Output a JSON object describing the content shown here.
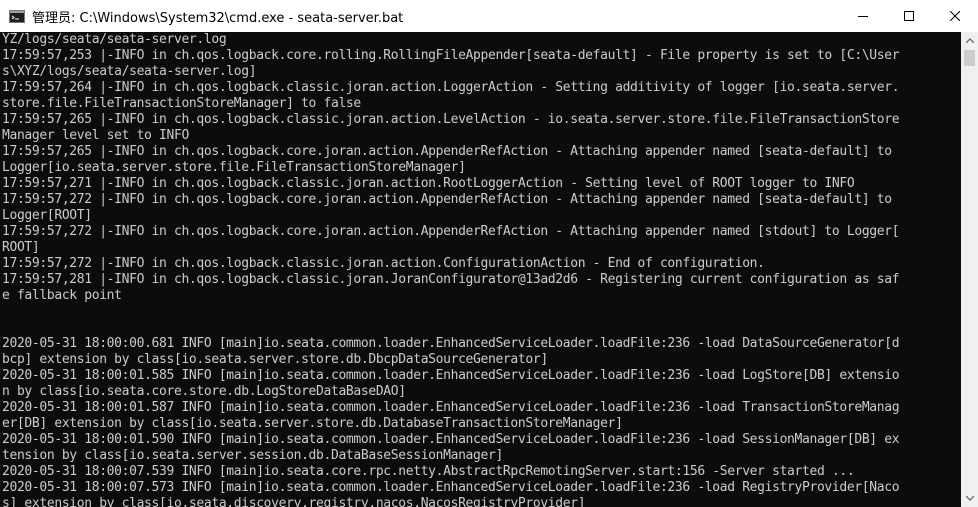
{
  "window": {
    "title": "管理员: C:\\Windows\\System32\\cmd.exe - seata-server.bat",
    "icon": "cmd-icon"
  },
  "titlebar_buttons": [
    {
      "name": "minimize-button",
      "icon": "minimize-icon"
    },
    {
      "name": "maximize-button",
      "icon": "maximize-icon"
    },
    {
      "name": "close-button",
      "icon": "close-icon"
    }
  ],
  "console": {
    "lines": [
      "YZ/logs/seata/seata-server.log",
      "17:59:57,253 |-INFO in ch.qos.logback.core.rolling.RollingFileAppender[seata-default] - File property is set to [C:\\User",
      "s\\XYZ/logs/seata/seata-server.log]",
      "17:59:57,264 |-INFO in ch.qos.logback.classic.joran.action.LoggerAction - Setting additivity of logger [io.seata.server.",
      "store.file.FileTransactionStoreManager] to false",
      "17:59:57,265 |-INFO in ch.qos.logback.classic.joran.action.LevelAction - io.seata.server.store.file.FileTransactionStore",
      "Manager level set to INFO",
      "17:59:57,265 |-INFO in ch.qos.logback.core.joran.action.AppenderRefAction - Attaching appender named [seata-default] to",
      "Logger[io.seata.server.store.file.FileTransactionStoreManager]",
      "17:59:57,271 |-INFO in ch.qos.logback.classic.joran.action.RootLoggerAction - Setting level of ROOT logger to INFO",
      "17:59:57,272 |-INFO in ch.qos.logback.core.joran.action.AppenderRefAction - Attaching appender named [seata-default] to",
      "Logger[ROOT]",
      "17:59:57,272 |-INFO in ch.qos.logback.core.joran.action.AppenderRefAction - Attaching appender named [stdout] to Logger[",
      "ROOT]",
      "17:59:57,272 |-INFO in ch.qos.logback.classic.joran.action.ConfigurationAction - End of configuration.",
      "17:59:57,281 |-INFO in ch.qos.logback.classic.joran.JoranConfigurator@13ad2d6 - Registering current configuration as saf",
      "e fallback point",
      "",
      "",
      "2020-05-31 18:00:00.681 INFO [main]io.seata.common.loader.EnhancedServiceLoader.loadFile:236 -load DataSourceGenerator[d",
      "bcp] extension by class[io.seata.server.store.db.DbcpDataSourceGenerator]",
      "2020-05-31 18:00:01.585 INFO [main]io.seata.common.loader.EnhancedServiceLoader.loadFile:236 -load LogStore[DB] extensio",
      "n by class[io.seata.core.store.db.LogStoreDataBaseDAO]",
      "2020-05-31 18:00:01.587 INFO [main]io.seata.common.loader.EnhancedServiceLoader.loadFile:236 -load TransactionStoreManag",
      "er[DB] extension by class[io.seata.server.store.db.DatabaseTransactionStoreManager]",
      "2020-05-31 18:00:01.590 INFO [main]io.seata.common.loader.EnhancedServiceLoader.loadFile:236 -load SessionManager[DB] ex",
      "tension by class[io.seata.server.session.db.DataBaseSessionManager]",
      "2020-05-31 18:00:07.539 INFO [main]io.seata.core.rpc.netty.AbstractRpcRemotingServer.start:156 -Server started ...",
      "2020-05-31 18:00:07.573 INFO [main]io.seata.common.loader.EnhancedServiceLoader.loadFile:236 -load RegistryProvider[Naco",
      "s] extension by class[io.seata.discovery.registry.nacos.NacosRegistryProvider]"
    ]
  },
  "colors": {
    "console_bg": "#0c0c0c",
    "console_fg": "#cccccc",
    "titlebar_bg": "#ffffff"
  }
}
